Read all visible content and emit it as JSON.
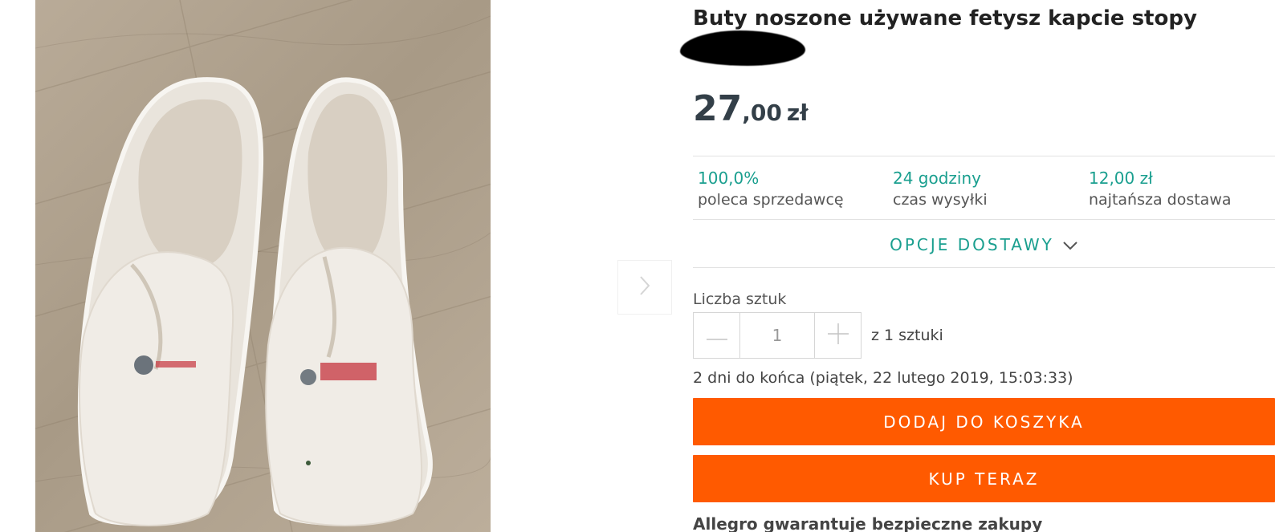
{
  "product": {
    "title": "Buty noszone używane fetysz kapcie stopy",
    "price": {
      "integer": "27",
      "decimal": ",00",
      "currency": "zł"
    }
  },
  "stats": [
    {
      "value": "100,0%",
      "label": "poleca sprzedawcę"
    },
    {
      "value": "24 godziny",
      "label": "czas wysyłki"
    },
    {
      "value": "12,00 zł",
      "label": "najtańsza dostawa"
    }
  ],
  "delivery": {
    "toggle_label": "OPCJE DOSTAWY"
  },
  "quantity": {
    "label": "Liczba sztuk",
    "value": "1",
    "of_text": "z 1 sztuki"
  },
  "ends": {
    "text": "2 dni do końca (piątek, 22 lutego 2019, 15:03:33)"
  },
  "actions": {
    "add_to_cart": "DODAJ DO KOSZYKA",
    "buy_now": "KUP TERAZ"
  },
  "guarantee": {
    "text": "Allegro gwarantuje bezpieczne zakupy"
  },
  "colors": {
    "accent_teal": "#1a9f8f",
    "cta_orange": "#ff5a00",
    "price_text": "#333f48"
  }
}
